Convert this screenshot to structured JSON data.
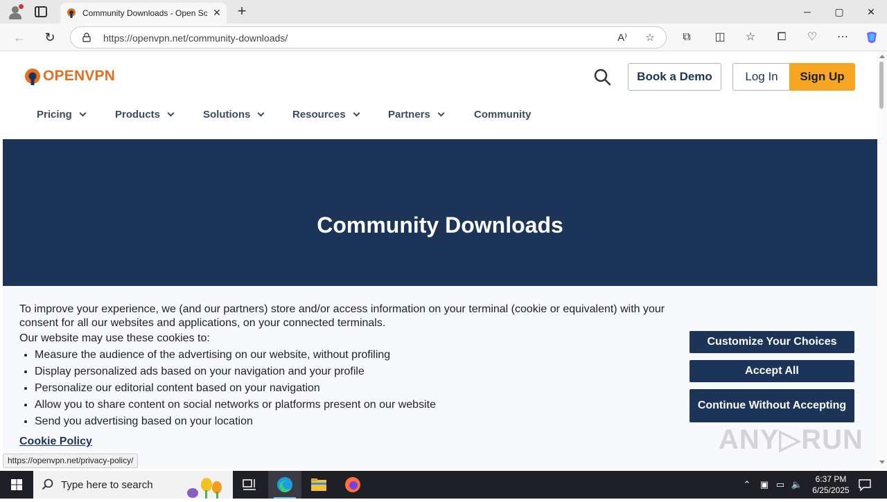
{
  "browser": {
    "tab_title": "Community Downloads - Open Source VPN",
    "url": "https://openvpn.net/community-downloads/",
    "close_tab": "✕",
    "new_tab": "+",
    "minimize": "─",
    "maximize": "▢",
    "close_window": "✕",
    "back": "←",
    "reload": "↻"
  },
  "header": {
    "logo_text": "OPENVPN",
    "book_demo": "Book a Demo",
    "log_in": "Log In",
    "sign_up": "Sign Up"
  },
  "nav": {
    "items": [
      {
        "label": "Pricing"
      },
      {
        "label": "Products"
      },
      {
        "label": "Solutions"
      },
      {
        "label": "Resources"
      },
      {
        "label": "Partners"
      },
      {
        "label": "Community"
      }
    ]
  },
  "hero": {
    "title": "Community Downloads"
  },
  "cookie": {
    "intro": "To improve your experience, we (and our partners) store and/or access information on your terminal (cookie or equivalent) with your consent for all our websites and applications, on your connected terminals.",
    "sub": "Our website may use these cookies to:",
    "items": [
      "Measure the audience of the advertising on our website, without profiling",
      "Display personalized ads based on your navigation and your profile",
      "Personalize our editorial content based on your navigation",
      "Allow you to share content on social networks or platforms present on our website",
      "Send you advertising based on your location"
    ],
    "policy_link": "Cookie Policy",
    "customize": "Customize Your Choices",
    "accept_all": "Accept All",
    "continue_without": "Continue Without Accepting"
  },
  "status_url": "https://openvpn.net/privacy-policy/",
  "watermark": "ANY▷RUN",
  "taskbar": {
    "search_placeholder": "Type here to search",
    "time": "6:37 PM",
    "date": "6/25/2025"
  },
  "colors": {
    "brand_navy": "#1c3458",
    "brand_orange": "#f6a623",
    "logo_orange": "#e46f21"
  }
}
